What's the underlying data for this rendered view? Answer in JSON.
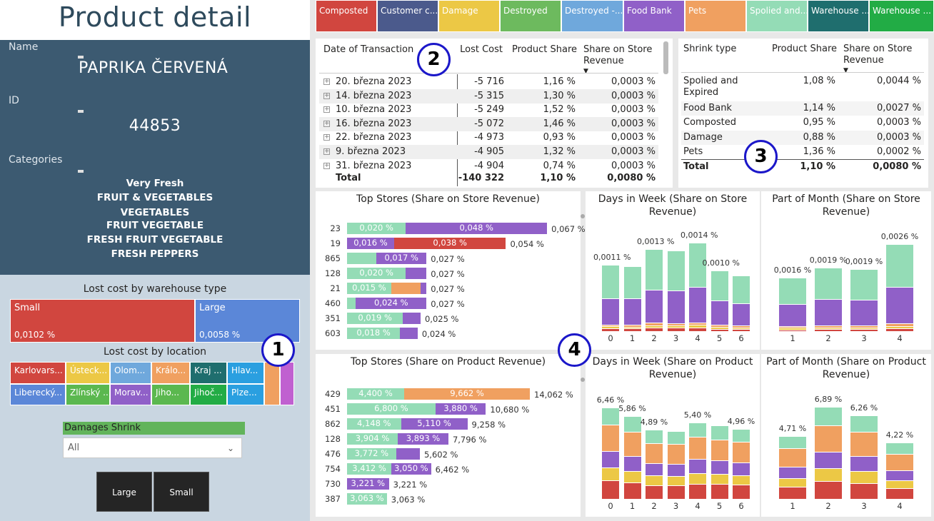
{
  "colors": {
    "Composted": "#d1463f",
    "Customer": "#4b5a8c",
    "Damage": "#ecc845",
    "Destroyed": "#6dba5e",
    "DestroyedOther": "#6fa8dc",
    "FoodBank": "#9060c8",
    "Pets": "#f0a060",
    "Spoiled": "#94dcb6",
    "WarehouseA": "#1f6e6e",
    "WarehouseB": "#22ac45"
  },
  "header": {
    "title": "Product detail"
  },
  "info": {
    "name_label": "Name",
    "name_value": "PAPRIKA ČERVENÁ",
    "id_label": "ID",
    "id_value": "44853",
    "categories_label": "Categories",
    "categories": [
      "Very Fresh",
      "FRUIT & VEGETABLES",
      "VEGETABLES",
      "FRUIT VEGETABLE",
      "FRESH FRUIT VEGETABLE",
      "FRESH PEPPERS"
    ]
  },
  "warehouse_type": {
    "title": "Lost cost by warehouse type",
    "items": [
      {
        "label": "Small",
        "value": "0,0102 %",
        "color": "#d1463f"
      },
      {
        "label": "Large",
        "value": "0,0058 %",
        "color": "#5b87d8"
      }
    ]
  },
  "location": {
    "title": "Lost cost by location",
    "items": [
      {
        "label": "Karlovars...",
        "color": "#d1463f"
      },
      {
        "label": "Ústeck...",
        "color": "#ecc845"
      },
      {
        "label": "Olom...",
        "color": "#6fa8dc"
      },
      {
        "label": "Králo...",
        "color": "#f0a060"
      },
      {
        "label": "Kraj ...",
        "color": "#1f6e6e"
      },
      {
        "label": "Hlav...",
        "color": "#2a9fe0"
      },
      {
        "label": "Liberecký...",
        "color": "#5b87d8"
      },
      {
        "label": "Zlínský ...",
        "color": "#5bb84f"
      },
      {
        "label": "Morav...",
        "color": "#9060c8"
      },
      {
        "label": "Jiho...",
        "color": "#5bb84f"
      },
      {
        "label": "Jihoč...",
        "color": "#22ac45"
      },
      {
        "label": "Plze...",
        "color": "#2a9fe0"
      }
    ]
  },
  "slicer": {
    "title": "Damages Shrink",
    "value": "All"
  },
  "buttons": {
    "large": "Large",
    "small": "Small"
  },
  "legend": [
    {
      "label": "Composted",
      "color": "#d1463f"
    },
    {
      "label": "Customer c...",
      "color": "#4b5a8c"
    },
    {
      "label": "Damage",
      "color": "#ecc845"
    },
    {
      "label": "Destroyed",
      "color": "#6dba5e"
    },
    {
      "label": "Destroyed -...",
      "color": "#6fa8dc"
    },
    {
      "label": "Food Bank",
      "color": "#9060c8"
    },
    {
      "label": "Pets",
      "color": "#f0a060"
    },
    {
      "label": "Spolied and...",
      "color": "#94dcb6"
    },
    {
      "label": "Warehouse ...",
      "color": "#1f6e6e"
    },
    {
      "label": "Warehouse ...",
      "color": "#22ac45"
    }
  ],
  "trans_table": {
    "headers": [
      "Date of Transaction",
      "Lost Cost",
      "Product Share",
      "Share on Store Revenue"
    ],
    "rows": [
      [
        "20. března 2023",
        "-5 716",
        "1,16 %",
        "0,0003 %"
      ],
      [
        "14. března 2023",
        "-5 315",
        "1,30 %",
        "0,0003 %"
      ],
      [
        "10. března 2023",
        "-5 249",
        "1,52 %",
        "0,0003 %"
      ],
      [
        "16. března 2023",
        "-5 072",
        "1,46 %",
        "0,0003 %"
      ],
      [
        "22. března 2023",
        "-4 973",
        "0,93 %",
        "0,0003 %"
      ],
      [
        "9. března 2023",
        "-4 905",
        "1,32 %",
        "0,0003 %"
      ],
      [
        "31. března 2023",
        "-4 904",
        "0,74 %",
        "0,0003 %"
      ]
    ],
    "total": [
      "Total",
      "-140 322",
      "1,10 %",
      "0,0080 %"
    ]
  },
  "shrink_table": {
    "headers": [
      "Shrink type",
      "Product Share",
      "Share on Store Revenue"
    ],
    "rows": [
      [
        "Spolied and Expired",
        "1,08 %",
        "0,0044 %"
      ],
      [
        "Food Bank",
        "1,14 %",
        "0,0027 %"
      ],
      [
        "Composted",
        "0,95 %",
        "0,0003 %"
      ],
      [
        "Damage",
        "0,88 %",
        "0,0003 %"
      ],
      [
        "Pets",
        "1,36 %",
        "0,0002 %"
      ]
    ],
    "total": [
      "Total",
      "1,10 %",
      "0,0080 %"
    ]
  },
  "badges": [
    "1",
    "2",
    "3",
    "4"
  ],
  "chart_data": [
    {
      "type": "bar",
      "title": "Top Stores (Share on Store Revenue)",
      "orientation": "horizontal-stacked",
      "categories": [
        "23",
        "19",
        "865",
        "128",
        "21",
        "460",
        "351",
        "603"
      ],
      "totals": [
        "0,067 %",
        "0,054 %",
        "0,027 %",
        "0,027 %",
        "0,027 %",
        "0,027 %",
        "0,025 %",
        "0,024 %"
      ],
      "rows": [
        [
          {
            "s": "Spoiled",
            "v": 0.02,
            "label": "0,020 %"
          },
          {
            "s": "FoodBank",
            "v": 0.048,
            "label": "0,048 %"
          }
        ],
        [
          {
            "s": "FoodBank",
            "v": 0.016,
            "label": "0,016 %"
          },
          {
            "s": "Composted",
            "v": 0.038,
            "label": "0,038 %"
          }
        ],
        [
          {
            "s": "Spoiled",
            "v": 0.01,
            "label": ""
          },
          {
            "s": "FoodBank",
            "v": 0.017,
            "label": "0,017 %"
          }
        ],
        [
          {
            "s": "Spoiled",
            "v": 0.02,
            "label": "0,020 %"
          },
          {
            "s": "FoodBank",
            "v": 0.007,
            "label": ""
          }
        ],
        [
          {
            "s": "Spoiled",
            "v": 0.015,
            "label": "0,015 %"
          },
          {
            "s": "Pets",
            "v": 0.01,
            "label": ""
          },
          {
            "s": "FoodBank",
            "v": 0.002,
            "label": ""
          }
        ],
        [
          {
            "s": "Spoiled",
            "v": 0.003,
            "label": ""
          },
          {
            "s": "FoodBank",
            "v": 0.024,
            "label": "0,024 %"
          }
        ],
        [
          {
            "s": "Spoiled",
            "v": 0.019,
            "label": "0,019 %"
          },
          {
            "s": "FoodBank",
            "v": 0.006,
            "label": ""
          }
        ],
        [
          {
            "s": "Spoiled",
            "v": 0.018,
            "label": "0,018 %"
          },
          {
            "s": "FoodBank",
            "v": 0.006,
            "label": ""
          }
        ]
      ],
      "xmax": 0.067
    },
    {
      "type": "bar",
      "title": "Top Stores (Share on Product Revenue)",
      "orientation": "horizontal-stacked",
      "categories": [
        "429",
        "451",
        "862",
        "128",
        "476",
        "754",
        "730",
        "387"
      ],
      "totals": [
        "14,062 %",
        "10,680 %",
        "9,258 %",
        "7,796 %",
        "5,602 %",
        "6,462 %",
        "3,221 %",
        "3,063 %"
      ],
      "rows": [
        [
          {
            "s": "Spoiled",
            "v": 4.4,
            "label": "4,400 %"
          },
          {
            "s": "Pets",
            "v": 9.662,
            "label": "9,662 %"
          }
        ],
        [
          {
            "s": "Spoiled",
            "v": 6.8,
            "label": "6,800 %"
          },
          {
            "s": "FoodBank",
            "v": 3.88,
            "label": "3,880 %"
          }
        ],
        [
          {
            "s": "Spoiled",
            "v": 4.148,
            "label": "4,148 %"
          },
          {
            "s": "FoodBank",
            "v": 5.11,
            "label": "5,110 %"
          }
        ],
        [
          {
            "s": "Spoiled",
            "v": 3.904,
            "label": "3,904 %"
          },
          {
            "s": "FoodBank",
            "v": 3.893,
            "label": "3,893 %"
          }
        ],
        [
          {
            "s": "Spoiled",
            "v": 3.772,
            "label": "3,772 %"
          },
          {
            "s": "FoodBank",
            "v": 1.83,
            "label": ""
          }
        ],
        [
          {
            "s": "Spoiled",
            "v": 3.412,
            "label": "3,412 %"
          },
          {
            "s": "FoodBank",
            "v": 3.05,
            "label": "3,050 %"
          }
        ],
        [
          {
            "s": "FoodBank",
            "v": 3.221,
            "label": "3,221 %"
          }
        ],
        [
          {
            "s": "Spoiled",
            "v": 3.063,
            "label": "3,063 %"
          }
        ]
      ],
      "xmax": 14.062
    },
    {
      "type": "bar",
      "title": "Days in Week (Share on Store Revenue)",
      "orientation": "vertical-stacked",
      "categories": [
        "0",
        "1",
        "2",
        "3",
        "4",
        "5",
        "6"
      ],
      "totals": [
        "0,0011 %",
        "",
        "0,0013 %",
        "",
        "0,0014 %",
        "0,0010 %",
        ""
      ],
      "values": [
        1.05,
        1.03,
        1.3,
        1.28,
        1.4,
        0.96,
        0.88
      ],
      "series_order": [
        "Composted",
        "Damage",
        "Pets",
        "FoodBank",
        "Spoiled"
      ],
      "fractions": [
        0.04,
        0.03,
        0.03,
        0.4,
        0.5
      ]
    },
    {
      "type": "bar",
      "title": "Part of Month (Share on Store Revenue)",
      "orientation": "vertical-stacked",
      "categories": [
        "1",
        "2",
        "3",
        "4"
      ],
      "totals": [
        "0,0016 %",
        "0,0019 %",
        "0,0019 %",
        "0,0026 %"
      ],
      "values": [
        1.6,
        1.9,
        1.85,
        2.6
      ],
      "series_order": [
        "Composted",
        "Damage",
        "Pets",
        "FoodBank",
        "Spoiled"
      ],
      "fractions": [
        0.03,
        0.03,
        0.03,
        0.42,
        0.49
      ]
    },
    {
      "type": "bar",
      "title": "Days in Week (Share on Product Revenue)",
      "orientation": "vertical-stacked",
      "categories": [
        "0",
        "1",
        "2",
        "3",
        "4",
        "5",
        "6"
      ],
      "totals": [
        "6,46 %",
        "5,86 %",
        "4,89 %",
        "",
        "5,40 %",
        "",
        "4,96 %"
      ],
      "values": [
        6.46,
        5.86,
        4.89,
        4.8,
        5.4,
        5.2,
        4.96
      ],
      "series_order": [
        "Composted",
        "Damage",
        "FoodBank",
        "Pets",
        "Spoiled"
      ],
      "fractions": [
        0.2,
        0.14,
        0.18,
        0.29,
        0.19
      ]
    },
    {
      "type": "bar",
      "title": "Part of Month (Share on Product Revenue)",
      "orientation": "vertical-stacked",
      "categories": [
        "1",
        "2",
        "3",
        "4"
      ],
      "totals": [
        "4,71 %",
        "6,89 %",
        "6,26 %",
        "4,22 %"
      ],
      "values": [
        4.71,
        6.89,
        6.26,
        4.22
      ],
      "series_order": [
        "Composted",
        "Damage",
        "FoodBank",
        "Pets",
        "Spoiled"
      ],
      "fractions": [
        0.19,
        0.14,
        0.18,
        0.29,
        0.2
      ]
    }
  ]
}
